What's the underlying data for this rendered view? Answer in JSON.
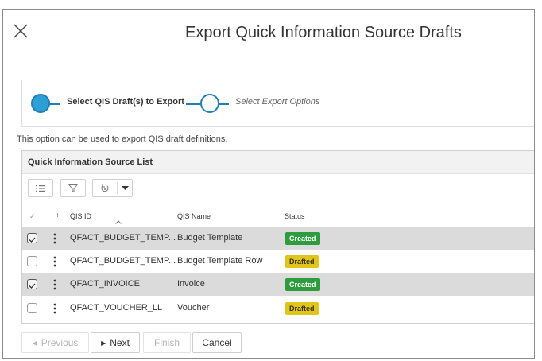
{
  "dialog": {
    "title": "Export Quick Information Source Drafts"
  },
  "wizard": {
    "steps": [
      {
        "label": "Select QIS Draft(s) to Export",
        "active": true
      },
      {
        "label": "Select Export Options",
        "active": false
      }
    ]
  },
  "info_text": "This option can be used to export QIS draft definitions.",
  "list": {
    "title": "Quick Information Source List",
    "toolbar": [
      {
        "name": "list-view-icon"
      },
      {
        "name": "filter-icon"
      },
      {
        "name": "reset-icon"
      }
    ],
    "columns": {
      "check": "✓",
      "menu": "⋮",
      "id": "QIS ID",
      "name": "QIS Name",
      "status": "Status"
    },
    "rows": [
      {
        "id": "QFACT_BUDGET_TEMP...",
        "name": "Budget Template",
        "status": "Created",
        "selected": true
      },
      {
        "id": "QFACT_BUDGET_TEMP...",
        "name": "Budget Template Row",
        "status": "Drafted",
        "selected": false
      },
      {
        "id": "QFACT_INVOICE",
        "name": "Invoice",
        "status": "Created",
        "selected": true
      },
      {
        "id": "QFACT_VOUCHER_LL",
        "name": "Voucher",
        "status": "Drafted",
        "selected": false
      }
    ]
  },
  "footer": {
    "previous": "Previous",
    "next": "Next",
    "finish": "Finish",
    "cancel": "Cancel"
  },
  "colors": {
    "accent": "#1e7fb5",
    "created": "#2d9c3c",
    "drafted": "#e0c51b"
  }
}
